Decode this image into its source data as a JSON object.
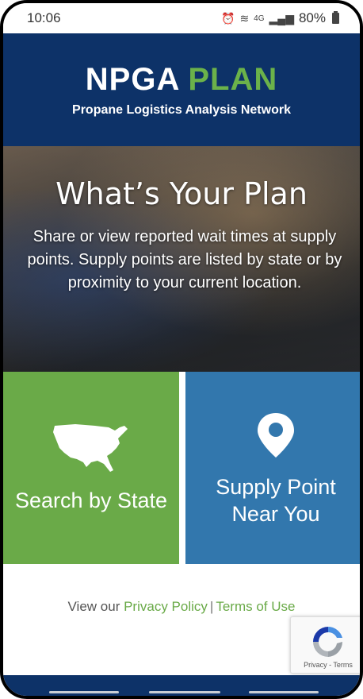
{
  "status": {
    "time": "10:06",
    "network": "4G",
    "battery": "80%"
  },
  "header": {
    "brand_primary": "NPGA",
    "brand_secondary": "PLAN",
    "tagline": "Propane Logistics Analysis Network"
  },
  "hero": {
    "title": "What’s Your Plan",
    "text": "Share or view reported wait times at supply points. Supply points are listed by state or by proximity to your current location."
  },
  "tiles": [
    {
      "label": "Search by State",
      "icon": "usa-map-icon",
      "color": "#6aaa48"
    },
    {
      "label_line1": "Supply Point",
      "label_line2": "Near You",
      "icon": "location-pin-icon",
      "color": "#3277ad"
    }
  ],
  "footer": {
    "prefix": "View our",
    "privacy": "Privacy Policy",
    "separator": "|",
    "terms": "Terms of Use"
  },
  "recaptcha": {
    "text": "Privacy - Terms"
  },
  "colors": {
    "brand_navy": "#0d3268",
    "brand_green": "#6aaa48",
    "tile_blue": "#3277ad"
  }
}
